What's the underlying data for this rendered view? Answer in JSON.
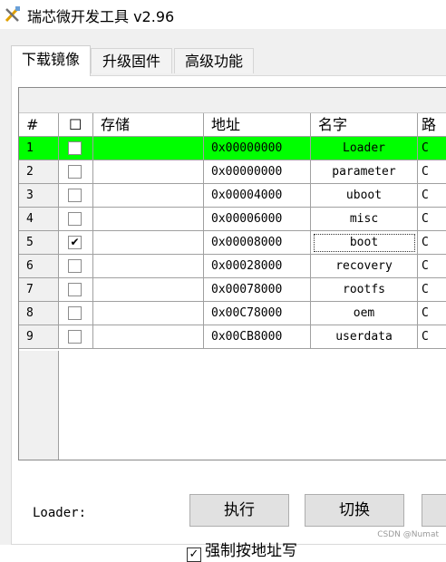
{
  "window": {
    "title": "瑞芯微开发工具 v2.96"
  },
  "tabs": [
    {
      "label": "下载镜像",
      "active": true
    },
    {
      "label": "升级固件",
      "active": false
    },
    {
      "label": "高级功能",
      "active": false
    }
  ],
  "table": {
    "headers": {
      "num": "#",
      "check": "☐",
      "storage": "存储",
      "address": "地址",
      "name": "名字",
      "extra": "路"
    },
    "rows": [
      {
        "num": "1",
        "checked": false,
        "storage": "",
        "address": "0x00000000",
        "name": "Loader",
        "extra": "C"
      },
      {
        "num": "2",
        "checked": false,
        "storage": "",
        "address": "0x00000000",
        "name": "parameter",
        "extra": "C"
      },
      {
        "num": "3",
        "checked": false,
        "storage": "",
        "address": "0x00004000",
        "name": "uboot",
        "extra": "C"
      },
      {
        "num": "4",
        "checked": false,
        "storage": "",
        "address": "0x00006000",
        "name": "misc",
        "extra": "C"
      },
      {
        "num": "5",
        "checked": true,
        "storage": "",
        "address": "0x00008000",
        "name": "boot",
        "extra": "C"
      },
      {
        "num": "6",
        "checked": false,
        "storage": "",
        "address": "0x00028000",
        "name": "recovery",
        "extra": "C"
      },
      {
        "num": "7",
        "checked": false,
        "storage": "",
        "address": "0x00078000",
        "name": "rootfs",
        "extra": "C"
      },
      {
        "num": "8",
        "checked": false,
        "storage": "",
        "address": "0x00C78000",
        "name": "oem",
        "extra": "C"
      },
      {
        "num": "9",
        "checked": false,
        "storage": "",
        "address": "0x00CB8000",
        "name": "userdata",
        "extra": "C"
      }
    ],
    "highlight_color": "#00ff00"
  },
  "status": {
    "label": "Loader:"
  },
  "buttons": {
    "run": "执行",
    "switch": "切换"
  },
  "force_address": {
    "label": "强制按地址写",
    "checked": true,
    "mark": "✓"
  },
  "check_mark": "✔",
  "watermark": "CSDN @Numat"
}
